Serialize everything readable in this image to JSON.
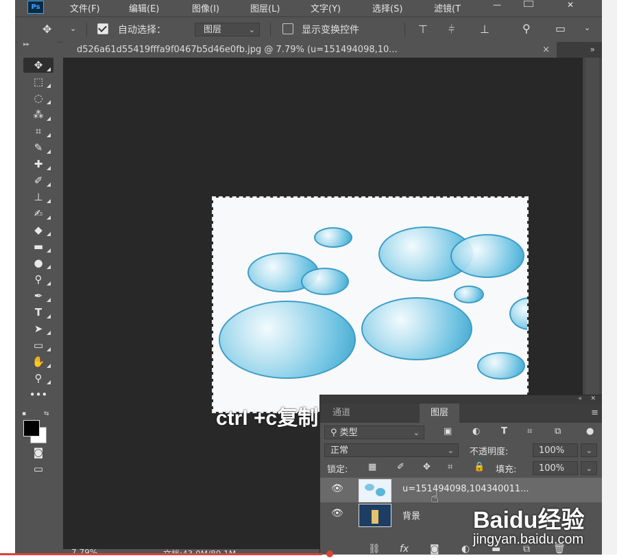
{
  "app": {
    "logo": "Ps"
  },
  "menu": {
    "items": [
      "文件(F)",
      "编辑(E)",
      "图像(I)",
      "图层(L)",
      "文字(Y)",
      "选择(S)",
      "滤镜(T"
    ]
  },
  "options": {
    "auto_select_label": "自动选择：",
    "auto_select_checked": true,
    "target_value": "图层",
    "transform_label": "显示变换控件",
    "transform_checked": false
  },
  "document": {
    "tab_title": "d526a61d55419fffa9f0467b5d46e0fb.jpg @ 7.79% (u=151494098,10...",
    "close_glyph": "×",
    "more_glyph": "»"
  },
  "tools": [
    "move",
    "marquee",
    "lasso",
    "magic-wand",
    "crop",
    "eyedropper",
    "healing",
    "brush",
    "stamp",
    "history-brush",
    "eraser",
    "gradient",
    "blur",
    "dodge",
    "pen",
    "type",
    "path-select",
    "shape",
    "hand",
    "zoom",
    "more"
  ],
  "canvas": {
    "caption": "ctrl +c复制"
  },
  "status": {
    "zoom": "7.79%",
    "doc_size": "文档:43.0M/89.1M"
  },
  "layers_panel": {
    "tabs": [
      "通道",
      "图层"
    ],
    "active_tab": "图层",
    "filter_label": "类型",
    "blend_mode": "正常",
    "opacity_label": "不透明度:",
    "opacity_value": "100%",
    "lock_label": "锁定:",
    "fill_label": "填充:",
    "fill_value": "100%",
    "layers": [
      {
        "name": "u=151494098,104340011...",
        "visible": true,
        "selected": true
      },
      {
        "name": "背景",
        "visible": true,
        "selected": false
      }
    ]
  },
  "watermark": {
    "logo": "Baidu经验",
    "url": "jingyan.baidu.com"
  },
  "colors": {
    "accent": "#31a8ff",
    "bubble": "#2e95c0",
    "status_line": "#d8433a"
  }
}
